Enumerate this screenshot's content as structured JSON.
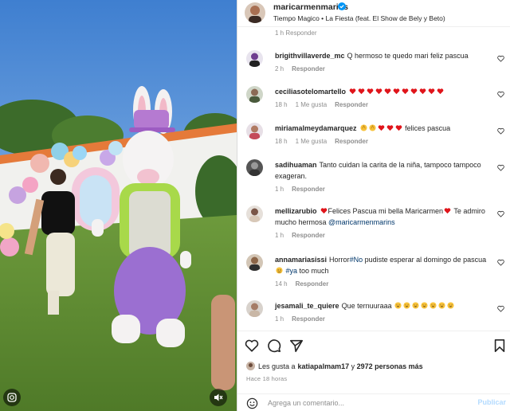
{
  "post": {
    "author": "maricarmenmarins",
    "audio": "Tiempo Magico • La Fiesta (feat. El Show de Bely y Beto)"
  },
  "cut_comment_meta": "1 h   Responder",
  "comments": [
    {
      "user": "brigithvillaverde_mc",
      "text": "Q hermoso te quedo mari feliz pascua",
      "time": "2 h",
      "likes": "",
      "reply": "Responder"
    },
    {
      "user": "ceciliasotelomartello",
      "text": "",
      "emojis": [
        "heart",
        "heart",
        "heart",
        "heart",
        "heart",
        "heart",
        "heart",
        "heart",
        "heart",
        "heart",
        "heart"
      ],
      "time": "18 h",
      "likes": "1 Me gusta",
      "reply": "Responder"
    },
    {
      "user": "miriamalmeydamarquez",
      "text": "felices pascua",
      "time": "18 h",
      "likes": "1 Me gusta",
      "reply": "Responder"
    },
    {
      "user": "sadihuaman",
      "text": "Tanto cuidan la carita de la niña, tampoco tampoco exageran.",
      "time": "1 h",
      "likes": "",
      "reply": "Responder"
    },
    {
      "user": "mellizarubio",
      "text_before": "Felices Pascua mi bella Maricarmen",
      "text_after": " Te admiro mucho hermosa ",
      "mention": "@maricarmenmarins",
      "time": "1 h",
      "likes": "",
      "reply": "Responder"
    },
    {
      "user": "annamariasissi",
      "text_before": "Horror",
      "hashtag1": "#No",
      "text_mid": " pudiste esperar al domingo de pascua ",
      "hashtag2": "#ya",
      "text_after": " too much",
      "time": "14 h",
      "likes": "",
      "reply": "Responder"
    },
    {
      "user": "jesamali_te_quiere",
      "text": "Que ternuuraaa",
      "time": "1 h",
      "likes": "",
      "reply": "Responder"
    }
  ],
  "likes": {
    "prefix": "Les gusta a ",
    "user": "katiapalmam17",
    "middle": " y ",
    "count": "2972 personas más"
  },
  "time_ago": "Hace 18 horas",
  "comment_box": {
    "placeholder": "Agrega un comentario...",
    "publish_label": "Publicar"
  },
  "colors": {
    "heart_red": "#e0151b",
    "link_blue": "#00376b",
    "verified_blue": "#0095f6",
    "publish_disabled": "#b3dbff"
  },
  "icons": [
    "heart-icon",
    "comment-icon",
    "share-icon",
    "bookmark-icon",
    "emoji-icon",
    "verified-icon",
    "mute-icon"
  ]
}
